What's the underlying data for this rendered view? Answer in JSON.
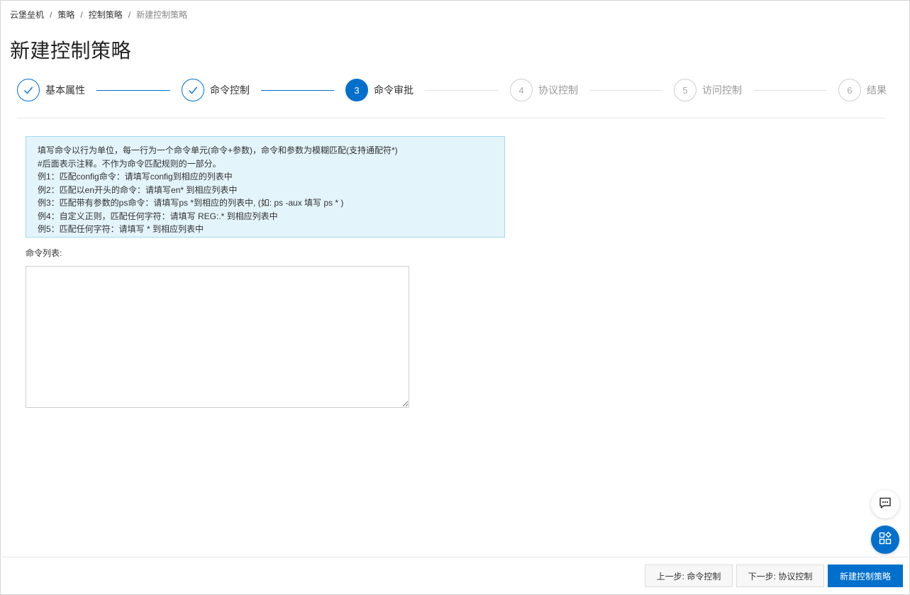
{
  "breadcrumb": {
    "items": [
      "云堡垒机",
      "策略",
      "控制策略"
    ],
    "separator": "/",
    "current": "新建控制策略"
  },
  "page": {
    "title": "新建控制策略"
  },
  "steps": [
    {
      "index": "1",
      "label": "基本属性",
      "status": "done"
    },
    {
      "index": "2",
      "label": "命令控制",
      "status": "done"
    },
    {
      "index": "3",
      "label": "命令审批",
      "status": "active"
    },
    {
      "index": "4",
      "label": "协议控制",
      "status": "todo"
    },
    {
      "index": "5",
      "label": "访问控制",
      "status": "todo"
    },
    {
      "index": "6",
      "label": "结果",
      "status": "todo"
    }
  ],
  "notice": {
    "lines": [
      "填写命令以行为单位，每一行为一个命令单元(命令+参数)，命令和参数为模糊匹配(支持通配符*)",
      "#后面表示注释。不作为命令匹配规则的一部分。",
      "例1：匹配config命令：请填写config到相应的列表中",
      "例2：匹配以en开头的命令：请填写en* 到相应列表中",
      "例3：匹配带有参数的ps命令：请填写ps *到相应的列表中, (如: ps -aux 填写 ps * )",
      "例4：自定义正则，匹配任何字符：请填写 REG:.* 到相应列表中",
      "例5：匹配任何字符：请填写 * 到相应列表中"
    ]
  },
  "form": {
    "command_list_label": "命令列表:",
    "command_list_value": "",
    "command_list_placeholder": ""
  },
  "floating": {
    "chat_icon": "chat-icon",
    "apps_icon": "apps-icon"
  },
  "footer": {
    "prev_label": "上一步: 命令控制",
    "next_label": "下一步: 协议控制",
    "submit_label": "新建控制策略"
  },
  "colors": {
    "primary": "#0070cc",
    "notice_bg": "#e3f4fb",
    "notice_border": "#a3d9ee"
  }
}
